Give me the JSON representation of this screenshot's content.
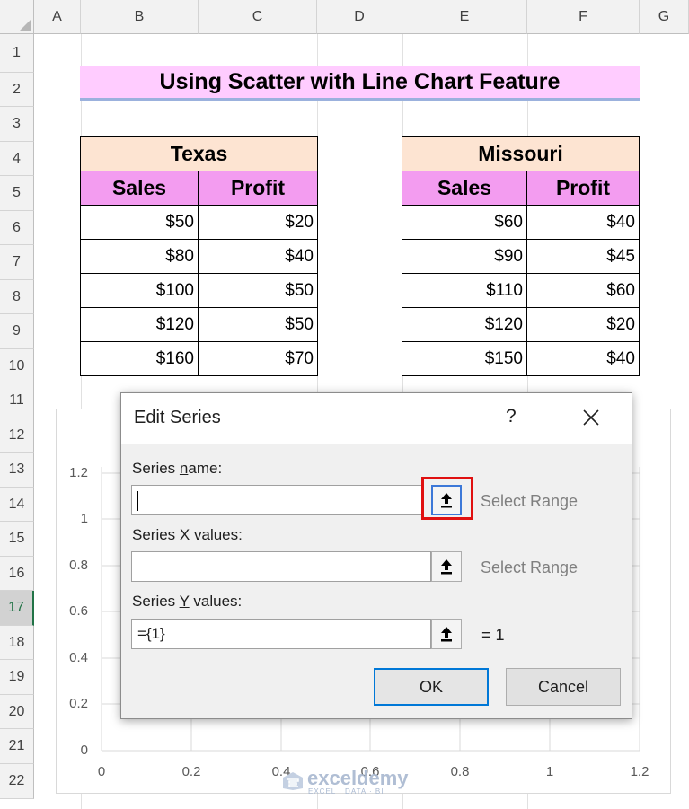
{
  "sheet": {
    "columns": [
      "A",
      "B",
      "C",
      "D",
      "E",
      "F",
      "G"
    ],
    "rows": [
      "1",
      "2",
      "3",
      "4",
      "5",
      "6",
      "7",
      "8",
      "9",
      "10",
      "11",
      "12",
      "13",
      "14",
      "15",
      "16",
      "17",
      "18",
      "19",
      "20",
      "21",
      "22"
    ],
    "title": "Using Scatter with Line Chart Feature"
  },
  "texas": {
    "header": "Texas",
    "col_sales": "Sales",
    "col_profit": "Profit",
    "rows": [
      {
        "sales": "$50",
        "profit": "$20"
      },
      {
        "sales": "$80",
        "profit": "$40"
      },
      {
        "sales": "$100",
        "profit": "$50"
      },
      {
        "sales": "$120",
        "profit": "$50"
      },
      {
        "sales": "$160",
        "profit": "$70"
      }
    ]
  },
  "missouri": {
    "header": "Missouri",
    "col_sales": "Sales",
    "col_profit": "Profit",
    "rows": [
      {
        "sales": "$60",
        "profit": "$40"
      },
      {
        "sales": "$90",
        "profit": "$45"
      },
      {
        "sales": "$110",
        "profit": "$60"
      },
      {
        "sales": "$120",
        "profit": "$20"
      },
      {
        "sales": "$150",
        "profit": "$40"
      }
    ]
  },
  "chart": {
    "y_ticks": [
      "1.2",
      "1",
      "0.8",
      "0.6",
      "0.4",
      "0.2",
      "0"
    ],
    "x_ticks": [
      "0",
      "0.2",
      "0.4",
      "0.6",
      "0.8",
      "1",
      "1.2"
    ]
  },
  "dialog": {
    "title": "Edit Series",
    "help": "?",
    "series_name_pre": "Series ",
    "series_name_key": "n",
    "series_name_post": "ame:",
    "series_name_value": "",
    "series_x_pre": "Series ",
    "series_x_key": "X",
    "series_x_post": " values:",
    "series_x_value": "",
    "series_y_pre": "Series ",
    "series_y_key": "Y",
    "series_y_post": " values:",
    "series_y_value": "={1}",
    "select_range": "Select Range",
    "y_result": "= 1",
    "ok": "OK",
    "cancel": "Cancel"
  },
  "watermark": {
    "brand": "exceldemy",
    "tagline": "EXCEL · DATA · BI"
  }
}
